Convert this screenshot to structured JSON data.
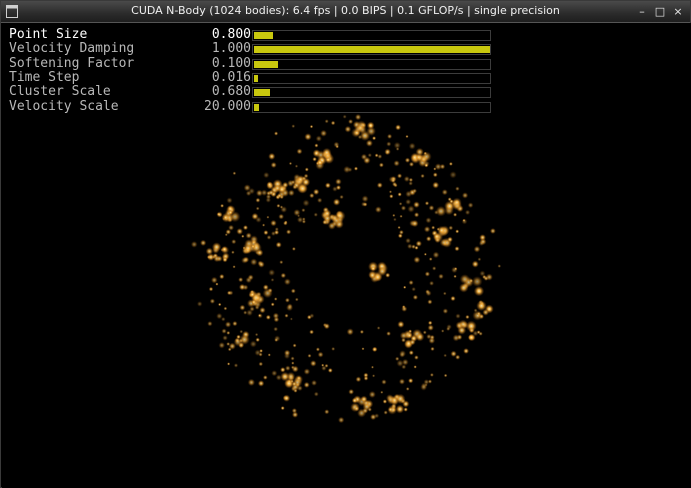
{
  "window": {
    "title": "CUDA N-Body (1024 bodies): 6.4 fps | 0.0 BIPS | 0.1 GFLOP/s | single precision",
    "icon": "app-window-icon",
    "controls": [
      {
        "name": "minimize",
        "glyph": "–"
      },
      {
        "name": "maximize",
        "glyph": "□"
      },
      {
        "name": "close",
        "glyph": "×"
      }
    ]
  },
  "params": [
    {
      "name": "Point Size",
      "value": "0.800",
      "fraction": 0.08,
      "selected": true
    },
    {
      "name": "Velocity Damping",
      "value": "1.000",
      "fraction": 1.0,
      "selected": false
    },
    {
      "name": "Softening Factor",
      "value": "0.100",
      "fraction": 0.1,
      "selected": false
    },
    {
      "name": "Time Step",
      "value": "0.016",
      "fraction": 0.016,
      "selected": false
    },
    {
      "name": "Cluster Scale",
      "value": "0.680",
      "fraction": 0.068,
      "selected": false
    },
    {
      "name": "Velocity Scale",
      "value": "20.000",
      "fraction": 0.02,
      "selected": false
    }
  ],
  "colors": {
    "bar_fill": "#c9c80e",
    "particle_core": "#fff3c4",
    "particle_mid": "#ffb840",
    "particle_glow": "#8a4a08"
  },
  "simulation": {
    "bodies": 1024
  }
}
